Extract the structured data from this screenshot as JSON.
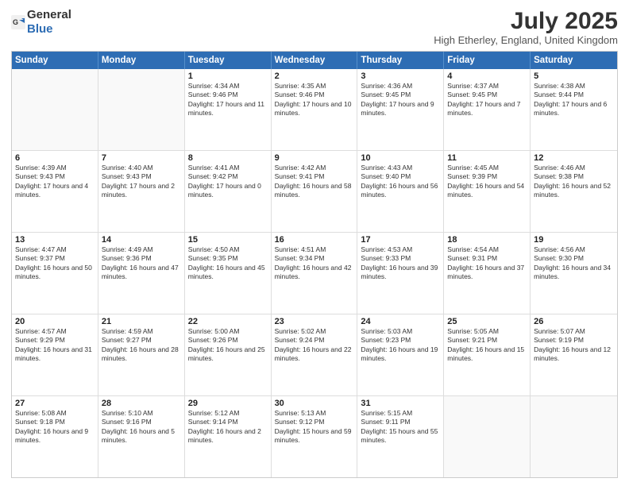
{
  "logo": {
    "general": "General",
    "blue": "Blue"
  },
  "title": {
    "month_year": "July 2025",
    "location": "High Etherley, England, United Kingdom"
  },
  "weekdays": [
    "Sunday",
    "Monday",
    "Tuesday",
    "Wednesday",
    "Thursday",
    "Friday",
    "Saturday"
  ],
  "rows": [
    [
      {
        "day": "",
        "text": ""
      },
      {
        "day": "",
        "text": ""
      },
      {
        "day": "1",
        "text": "Sunrise: 4:34 AM\nSunset: 9:46 PM\nDaylight: 17 hours and 11 minutes."
      },
      {
        "day": "2",
        "text": "Sunrise: 4:35 AM\nSunset: 9:46 PM\nDaylight: 17 hours and 10 minutes."
      },
      {
        "day": "3",
        "text": "Sunrise: 4:36 AM\nSunset: 9:45 PM\nDaylight: 17 hours and 9 minutes."
      },
      {
        "day": "4",
        "text": "Sunrise: 4:37 AM\nSunset: 9:45 PM\nDaylight: 17 hours and 7 minutes."
      },
      {
        "day": "5",
        "text": "Sunrise: 4:38 AM\nSunset: 9:44 PM\nDaylight: 17 hours and 6 minutes."
      }
    ],
    [
      {
        "day": "6",
        "text": "Sunrise: 4:39 AM\nSunset: 9:43 PM\nDaylight: 17 hours and 4 minutes."
      },
      {
        "day": "7",
        "text": "Sunrise: 4:40 AM\nSunset: 9:43 PM\nDaylight: 17 hours and 2 minutes."
      },
      {
        "day": "8",
        "text": "Sunrise: 4:41 AM\nSunset: 9:42 PM\nDaylight: 17 hours and 0 minutes."
      },
      {
        "day": "9",
        "text": "Sunrise: 4:42 AM\nSunset: 9:41 PM\nDaylight: 16 hours and 58 minutes."
      },
      {
        "day": "10",
        "text": "Sunrise: 4:43 AM\nSunset: 9:40 PM\nDaylight: 16 hours and 56 minutes."
      },
      {
        "day": "11",
        "text": "Sunrise: 4:45 AM\nSunset: 9:39 PM\nDaylight: 16 hours and 54 minutes."
      },
      {
        "day": "12",
        "text": "Sunrise: 4:46 AM\nSunset: 9:38 PM\nDaylight: 16 hours and 52 minutes."
      }
    ],
    [
      {
        "day": "13",
        "text": "Sunrise: 4:47 AM\nSunset: 9:37 PM\nDaylight: 16 hours and 50 minutes."
      },
      {
        "day": "14",
        "text": "Sunrise: 4:49 AM\nSunset: 9:36 PM\nDaylight: 16 hours and 47 minutes."
      },
      {
        "day": "15",
        "text": "Sunrise: 4:50 AM\nSunset: 9:35 PM\nDaylight: 16 hours and 45 minutes."
      },
      {
        "day": "16",
        "text": "Sunrise: 4:51 AM\nSunset: 9:34 PM\nDaylight: 16 hours and 42 minutes."
      },
      {
        "day": "17",
        "text": "Sunrise: 4:53 AM\nSunset: 9:33 PM\nDaylight: 16 hours and 39 minutes."
      },
      {
        "day": "18",
        "text": "Sunrise: 4:54 AM\nSunset: 9:31 PM\nDaylight: 16 hours and 37 minutes."
      },
      {
        "day": "19",
        "text": "Sunrise: 4:56 AM\nSunset: 9:30 PM\nDaylight: 16 hours and 34 minutes."
      }
    ],
    [
      {
        "day": "20",
        "text": "Sunrise: 4:57 AM\nSunset: 9:29 PM\nDaylight: 16 hours and 31 minutes."
      },
      {
        "day": "21",
        "text": "Sunrise: 4:59 AM\nSunset: 9:27 PM\nDaylight: 16 hours and 28 minutes."
      },
      {
        "day": "22",
        "text": "Sunrise: 5:00 AM\nSunset: 9:26 PM\nDaylight: 16 hours and 25 minutes."
      },
      {
        "day": "23",
        "text": "Sunrise: 5:02 AM\nSunset: 9:24 PM\nDaylight: 16 hours and 22 minutes."
      },
      {
        "day": "24",
        "text": "Sunrise: 5:03 AM\nSunset: 9:23 PM\nDaylight: 16 hours and 19 minutes."
      },
      {
        "day": "25",
        "text": "Sunrise: 5:05 AM\nSunset: 9:21 PM\nDaylight: 16 hours and 15 minutes."
      },
      {
        "day": "26",
        "text": "Sunrise: 5:07 AM\nSunset: 9:19 PM\nDaylight: 16 hours and 12 minutes."
      }
    ],
    [
      {
        "day": "27",
        "text": "Sunrise: 5:08 AM\nSunset: 9:18 PM\nDaylight: 16 hours and 9 minutes."
      },
      {
        "day": "28",
        "text": "Sunrise: 5:10 AM\nSunset: 9:16 PM\nDaylight: 16 hours and 5 minutes."
      },
      {
        "day": "29",
        "text": "Sunrise: 5:12 AM\nSunset: 9:14 PM\nDaylight: 16 hours and 2 minutes."
      },
      {
        "day": "30",
        "text": "Sunrise: 5:13 AM\nSunset: 9:12 PM\nDaylight: 15 hours and 59 minutes."
      },
      {
        "day": "31",
        "text": "Sunrise: 5:15 AM\nSunset: 9:11 PM\nDaylight: 15 hours and 55 minutes."
      },
      {
        "day": "",
        "text": ""
      },
      {
        "day": "",
        "text": ""
      }
    ]
  ]
}
